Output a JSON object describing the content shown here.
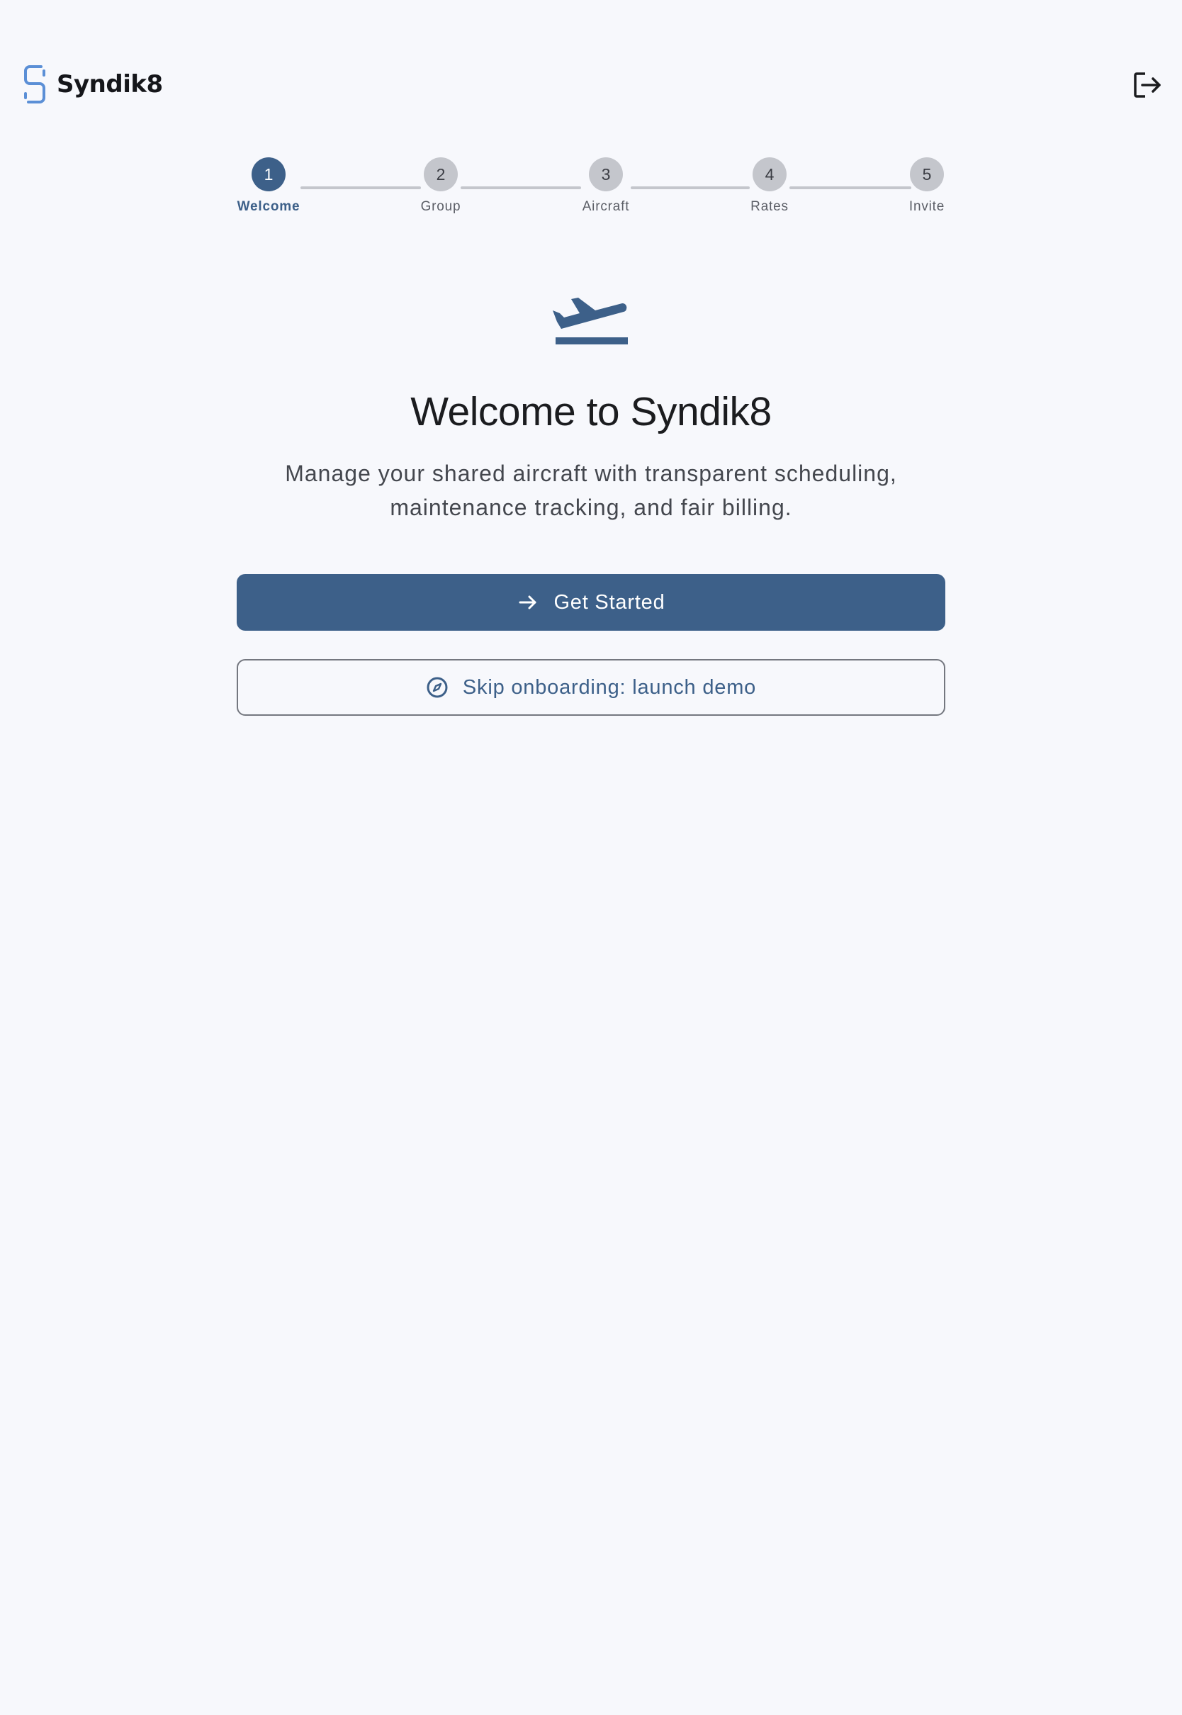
{
  "header": {
    "brand_name": "Syndik8",
    "brand_logo_icon": "syndik8-s-logo-icon",
    "logout_icon": "logout-icon"
  },
  "stepper": {
    "steps": [
      {
        "number": "1",
        "label": "Welcome",
        "active": true
      },
      {
        "number": "2",
        "label": "Group",
        "active": false
      },
      {
        "number": "3",
        "label": "Aircraft",
        "active": false
      },
      {
        "number": "4",
        "label": "Rates",
        "active": false
      },
      {
        "number": "5",
        "label": "Invite",
        "active": false
      }
    ]
  },
  "hero": {
    "icon": "flight-takeoff-icon",
    "title": "Welcome to Syndik8",
    "subtitle_line1": "Manage your shared aircraft with transparent scheduling,",
    "subtitle_line2": "maintenance tracking, and fair billing."
  },
  "actions": {
    "primary_label": "Get Started",
    "primary_icon": "arrow-right-icon",
    "secondary_label": "Skip onboarding: launch demo",
    "secondary_icon": "compass-icon"
  },
  "colors": {
    "background": "#f7f8fc",
    "accent": "#3d6089",
    "logo_accent": "#5b8fd6",
    "step_inactive": "#c4c6cc",
    "text_primary": "#1b1c1f",
    "text_secondary": "#44474e",
    "outline": "#74777f"
  }
}
